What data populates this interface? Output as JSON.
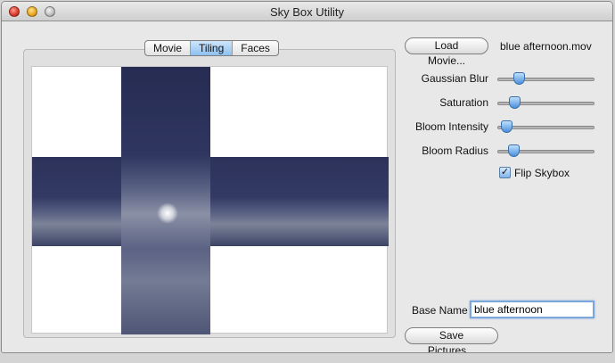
{
  "window": {
    "title": "Sky Box Utility"
  },
  "tabs": [
    {
      "label": "Movie",
      "active": false
    },
    {
      "label": "Tiling",
      "active": true
    },
    {
      "label": "Faces",
      "active": false
    }
  ],
  "controls": {
    "load_movie_label": "Load Movie...",
    "movie_filename": "blue afternoon.mov",
    "sliders": [
      {
        "label": "Gaussian Blur",
        "value": 0.2
      },
      {
        "label": "Saturation",
        "value": 0.1
      },
      {
        "label": "Bloom Intensity",
        "value": 0.05
      },
      {
        "label": "Bloom Radius",
        "value": 0.12
      }
    ],
    "flip_skybox": {
      "label": "Flip Skybox",
      "checked": true,
      "glyph": "✓"
    },
    "base_name_label": "Base Name",
    "base_name_value": "blue afternoon",
    "save_pictures_label": "Save Pictures..."
  },
  "colors": {
    "sky_dark": "#2c325a",
    "accent": "#7ba7dd"
  }
}
